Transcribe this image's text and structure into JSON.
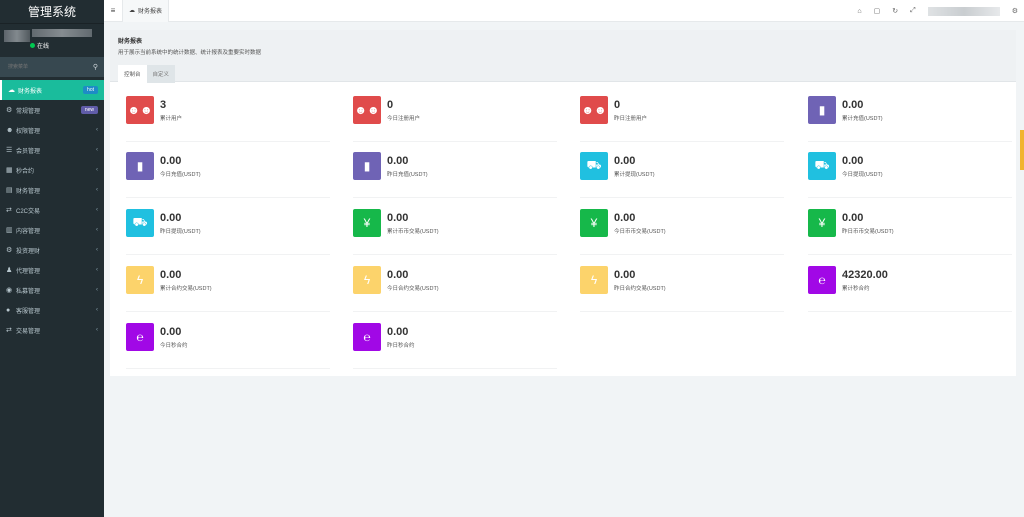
{
  "app": {
    "title": "管理系统"
  },
  "user": {
    "status": "在线"
  },
  "sidebar": {
    "search_placeholder": "搜索菜单",
    "items": [
      {
        "label": "财务报表",
        "badge": "hot",
        "icon": "dashboard-icon",
        "active": true
      },
      {
        "label": "常规管理",
        "badge": "new",
        "icon": "gears-icon"
      },
      {
        "label": "权限管理",
        "icon": "users-icon"
      },
      {
        "label": "会员管理",
        "icon": "list-icon"
      },
      {
        "label": "秒合约",
        "icon": "calendar-icon"
      },
      {
        "label": "财务管理",
        "icon": "table-icon"
      },
      {
        "label": "C2C交易",
        "icon": "exchange-icon"
      },
      {
        "label": "内容管理",
        "icon": "book-icon"
      },
      {
        "label": "投资理财",
        "icon": "gear-icon"
      },
      {
        "label": "代理管理",
        "icon": "user-group-icon"
      },
      {
        "label": "私募管理",
        "icon": "eye-icon"
      },
      {
        "label": "客服管理",
        "icon": "comment-icon"
      },
      {
        "label": "交易管理",
        "icon": "exchange-icon-2"
      }
    ]
  },
  "topbar": {
    "menu_icon": "hamburger-icon",
    "tab_label": "财务报表",
    "right_icons": [
      "home-icon",
      "trash-icon",
      "refresh-icon",
      "fullscreen-icon",
      "settings-icon"
    ]
  },
  "content": {
    "title": "财务报表",
    "subtitle": "用于展示当前系统中的统计数据、统计报表及重要实时数据",
    "tabs": [
      "控制台",
      "自定义"
    ]
  },
  "stats": [
    {
      "value": "3",
      "label": "累计用户",
      "color": "#e04b4b",
      "icon": "users-icon"
    },
    {
      "value": "0",
      "label": "今日注册用户",
      "color": "#e04b4b",
      "icon": "users-icon"
    },
    {
      "value": "0",
      "label": "昨日注册用户",
      "color": "#e04b4b",
      "icon": "users-icon"
    },
    {
      "value": "0.00",
      "label": "累计充值(USDT)",
      "color": "#6f63b5",
      "icon": "book-icon"
    },
    {
      "value": "0.00",
      "label": "今日充值(USDT)",
      "color": "#6f63b5",
      "icon": "book-icon"
    },
    {
      "value": "0.00",
      "label": "昨日充值(USDT)",
      "color": "#6f63b5",
      "icon": "book-icon"
    },
    {
      "value": "0.00",
      "label": "累计提现(USDT)",
      "color": "#20c0e0",
      "icon": "shopping-bag-icon"
    },
    {
      "value": "0.00",
      "label": "今日提现(USDT)",
      "color": "#20c0e0",
      "icon": "shopping-bag-icon"
    },
    {
      "value": "0.00",
      "label": "昨日提现(USDT)",
      "color": "#20c0e0",
      "icon": "shopping-bag-icon"
    },
    {
      "value": "0.00",
      "label": "累计币币交易(USDT)",
      "color": "#16b84a",
      "icon": "yen-icon"
    },
    {
      "value": "0.00",
      "label": "今日币币交易(USDT)",
      "color": "#16b84a",
      "icon": "yen-icon"
    },
    {
      "value": "0.00",
      "label": "昨日币币交易(USDT)",
      "color": "#16b84a",
      "icon": "yen-icon"
    },
    {
      "value": "0.00",
      "label": "累计合约交易(USDT)",
      "color": "#fcd36b",
      "icon": "lightning-icon"
    },
    {
      "value": "0.00",
      "label": "今日合约交易(USDT)",
      "color": "#fcd36b",
      "icon": "lightning-icon"
    },
    {
      "value": "0.00",
      "label": "昨日合约交易(USDT)",
      "color": "#fcd36b",
      "icon": "lightning-icon"
    },
    {
      "value": "42320.00",
      "label": "累计秒合约",
      "color": "#a108e6",
      "icon": "ie-icon"
    },
    {
      "value": "0.00",
      "label": "今日秒合约",
      "color": "#a108e6",
      "icon": "ie-icon"
    },
    {
      "value": "0.00",
      "label": "昨日秒合约",
      "color": "#a108e6",
      "icon": "ie-icon"
    }
  ]
}
